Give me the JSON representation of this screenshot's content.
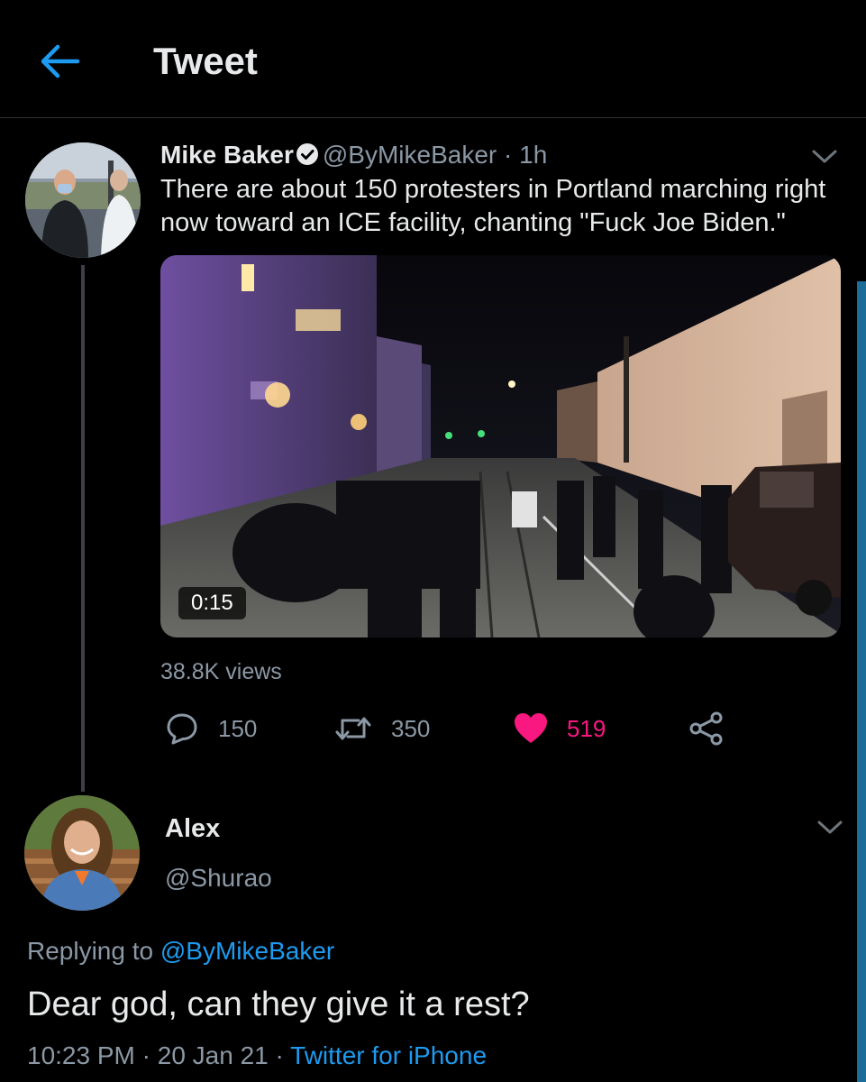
{
  "header": {
    "title": "Tweet",
    "back_icon": "arrow-left-icon"
  },
  "tweet": {
    "author_name": "Mike Baker",
    "verified": true,
    "handle": "@ByMikeBaker",
    "separator": " · ",
    "time_ago": "1h",
    "text": "There are about 150 protesters in Portland marching right now toward an ICE facility, chanting \"Fuck Joe Biden.\"",
    "media": {
      "duration": "0:15"
    },
    "views": "38.8K views",
    "actions": {
      "replies": "150",
      "retweets": "350",
      "likes": "519"
    }
  },
  "reply": {
    "author_name": "Alex",
    "handle": "@Shurao",
    "replying_prefix": "Replying to ",
    "replying_to": "@ByMikeBaker",
    "text": "Dear god, can they give it a rest?",
    "time": "10:23 PM",
    "separator": " · ",
    "date": "20 Jan 21",
    "source": "Twitter for iPhone"
  },
  "colors": {
    "accent": "#1d9bf0",
    "like": "#f91880",
    "background": "#000000",
    "secondary_text": "#8b98a5"
  }
}
